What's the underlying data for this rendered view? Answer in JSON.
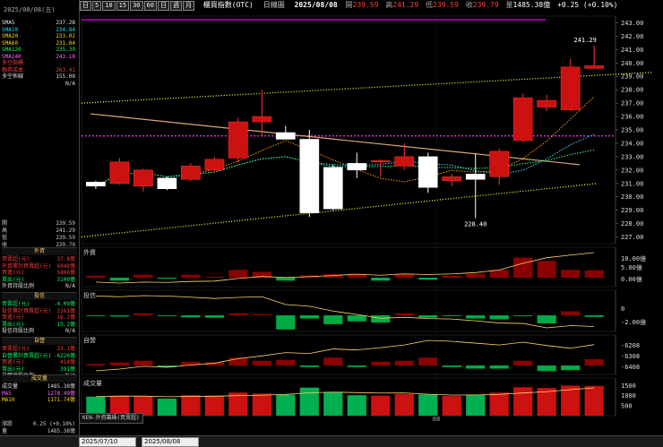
{
  "header": {
    "title": "櫃買指數(OTC)",
    "view": "日線圖",
    "date": "2025/08/08",
    "open_label": "開",
    "open": "239.59",
    "high_label": "高",
    "high": "241.29",
    "low_label": "低",
    "low": "239.59",
    "close_label": "收",
    "close": "239.79",
    "volume_label": "量",
    "volume": "1485.38億",
    "change": "+0.25 (+0.10%)",
    "period_buttons": [
      "日",
      "5",
      "10",
      "15",
      "30",
      "60",
      "日",
      "週",
      "月"
    ]
  },
  "left_panel": {
    "date": "2025/08/08(五)",
    "ma_rows": [
      {
        "label": "SMA5",
        "value": "237.28",
        "color": "#e6e6e6"
      },
      {
        "label": "SMA10",
        "value": "234.84",
        "color": "#00e5ff"
      },
      {
        "label": "SMA20",
        "value": "233.02",
        "color": "#ffd700"
      },
      {
        "label": "SMA60",
        "value": "231.04",
        "color": "#ffd700"
      },
      {
        "label": "SMA120",
        "value": "235.39",
        "color": "#00ff66"
      },
      {
        "label": "SMA240",
        "value": "243.18",
        "color": "#ff66ff"
      },
      {
        "label": "多空指標",
        "value": "",
        "color": "#ff3b3b"
      },
      {
        "label": "融券成本",
        "value": "263.41",
        "color": "#ff3b3b"
      },
      {
        "label": "多空佈線",
        "value": "155.08",
        "color": "#ddd"
      },
      {
        "label": "",
        "value": "N/A",
        "color": "#ddd"
      }
    ],
    "ohlc_rows": [
      {
        "label": "開",
        "value": "239.59"
      },
      {
        "label": "高",
        "value": "241.29"
      },
      {
        "label": "低",
        "value": "239.59"
      },
      {
        "label": "收",
        "value": "239.79"
      }
    ],
    "sections": [
      {
        "title": "外資",
        "rows": [
          {
            "label": "買賣超(元)",
            "value": "37.8億",
            "color": "#ff3b3b"
          },
          {
            "label": "外資累計買賣超(元)",
            "value": "6948億",
            "color": "#ff3b3b"
          },
          {
            "label": "買進(元)",
            "value": "5866億",
            "color": "#ff3b3b"
          },
          {
            "label": "賣出(元)",
            "value": "3100億",
            "color": "#00ff66"
          },
          {
            "label": "外資持股比例",
            "value": "N/A",
            "color": "#ddd"
          }
        ]
      },
      {
        "title": "投信",
        "rows": [
          {
            "label": "買賣超(元)",
            "value": "-4.09億",
            "color": "#00ff66"
          },
          {
            "label": "投信累計買賣超(元)",
            "value": "2161億",
            "color": "#ff3b3b"
          },
          {
            "label": "買進(元)",
            "value": "16.2億",
            "color": "#ff3b3b"
          },
          {
            "label": "賣出(元)",
            "value": "15.2億",
            "color": "#00ff66"
          },
          {
            "label": "投信持股比例",
            "value": "N/A",
            "color": "#ddd"
          }
        ]
      },
      {
        "title": "自營",
        "rows": [
          {
            "label": "買賣超(元)",
            "value": "23.1億",
            "color": "#ff3b3b"
          },
          {
            "label": "自營累計買賣超(元)",
            "value": "-6226億",
            "color": "#00ff66"
          },
          {
            "label": "買進(元)",
            "value": "414億",
            "color": "#ff3b3b"
          },
          {
            "label": "賣出(元)",
            "value": "391億",
            "color": "#00ff66"
          },
          {
            "label": "自營持股比例",
            "value": "N/A",
            "color": "#ddd"
          }
        ]
      },
      {
        "title": "成交量",
        "rows": [
          {
            "label": "成交量",
            "value": "1485.38億",
            "color": "#ddd"
          },
          {
            "label": "MA5",
            "value": "1278.49億",
            "color": "#ff66ff"
          },
          {
            "label": "MA10",
            "value": "1171.74億",
            "color": "#ffd700"
          }
        ]
      }
    ],
    "bottom_labels": [
      "漲跌",
      "量"
    ],
    "bottom_values": [
      "0.25 (+0.10%)",
      "1485.38億"
    ],
    "indicator_tab": "KEN-外資籌碼(買賣超)"
  },
  "price_axis": [
    "243.00",
    "242.00",
    "241.00",
    "240.00",
    "239.00",
    "238.00",
    "237.00",
    "236.00",
    "235.00",
    "234.00",
    "233.00",
    "232.00",
    "231.00",
    "230.00",
    "229.00",
    "228.00",
    "227.00"
  ],
  "annotations": {
    "high_label": "241.29",
    "low_label": "228.40",
    "start_date": "2025/07/10",
    "mid_date": "08"
  },
  "panels": [
    {
      "name": "外資",
      "axis": [
        "10.00億",
        "5.00億",
        "0.00億"
      ]
    },
    {
      "name": "投信",
      "axis": [
        "0",
        "-2.00億"
      ]
    },
    {
      "name": "自營",
      "axis": [
        "-6208",
        "-6308",
        "-6408"
      ]
    },
    {
      "name": "成交量",
      "axis": [
        "1500",
        "1000",
        "500"
      ]
    }
  ],
  "chart_data": {
    "type": "candlestick",
    "ylim": [
      226.5,
      243.5
    ],
    "candles": [
      {
        "o": 231.1,
        "h": 231.2,
        "l": 230.6,
        "c": 230.8
      },
      {
        "o": 231.0,
        "h": 232.9,
        "l": 230.9,
        "c": 232.6
      },
      {
        "o": 230.8,
        "h": 232.1,
        "l": 230.4,
        "c": 232.0
      },
      {
        "o": 231.4,
        "h": 231.5,
        "l": 230.5,
        "c": 230.6
      },
      {
        "o": 231.3,
        "h": 232.5,
        "l": 231.2,
        "c": 232.3
      },
      {
        "o": 232.0,
        "h": 233.0,
        "l": 231.8,
        "c": 232.8
      },
      {
        "o": 232.9,
        "h": 235.9,
        "l": 232.6,
        "c": 235.6
      },
      {
        "o": 235.6,
        "h": 238.0,
        "l": 234.6,
        "c": 236.0
      },
      {
        "o": 234.8,
        "h": 235.3,
        "l": 234.4,
        "c": 234.3
      },
      {
        "o": 234.3,
        "h": 235.0,
        "l": 228.5,
        "c": 228.8
      },
      {
        "o": 232.2,
        "h": 232.4,
        "l": 229.0,
        "c": 229.1
      },
      {
        "o": 232.5,
        "h": 233.3,
        "l": 231.4,
        "c": 232.0
      },
      {
        "o": 232.6,
        "h": 232.8,
        "l": 231.5,
        "c": 232.7
      },
      {
        "o": 232.3,
        "h": 234.0,
        "l": 232.0,
        "c": 233.0
      },
      {
        "o": 233.0,
        "h": 233.3,
        "l": 230.3,
        "c": 230.7
      },
      {
        "o": 231.2,
        "h": 231.7,
        "l": 230.8,
        "c": 231.5
      },
      {
        "o": 231.7,
        "h": 233.2,
        "l": 228.4,
        "c": 231.3
      },
      {
        "o": 231.5,
        "h": 233.6,
        "l": 230.9,
        "c": 233.4
      },
      {
        "o": 234.2,
        "h": 237.7,
        "l": 234.1,
        "c": 237.4
      },
      {
        "o": 236.7,
        "h": 237.6,
        "l": 236.4,
        "c": 237.2
      },
      {
        "o": 236.5,
        "h": 240.3,
        "l": 236.4,
        "c": 239.7
      },
      {
        "o": 239.59,
        "h": 241.29,
        "l": 239.59,
        "c": 239.79
      }
    ],
    "foreign": [
      1.0,
      -1.5,
      1.5,
      -0.5,
      1.5,
      0.5,
      4.0,
      3.0,
      -1.5,
      1.2,
      1.8,
      2.0,
      -1.5,
      2.0,
      -1.0,
      1.0,
      2.0,
      4.0,
      10.2,
      8.5,
      4.0,
      3.8
    ],
    "trust": [
      -0.2,
      -0.3,
      0.5,
      -0.2,
      -0.5,
      -0.6,
      0.5,
      0.3,
      -3.5,
      -0.8,
      -2.2,
      -1.5,
      -1.8,
      0.5,
      -0.6,
      -0.2,
      -0.8,
      -1.0,
      -0.2,
      -2.0,
      1.0,
      -0.4
    ],
    "dealer": [
      0.5,
      1.0,
      1.5,
      -0.5,
      1.2,
      1.0,
      2.5,
      1.5,
      1.8,
      -0.5,
      2.5,
      -0.5,
      1.2,
      1.5,
      2.5,
      -0.5,
      -1.0,
      -1.0,
      1.5,
      -1.8,
      -1.5,
      2.0
    ],
    "volume": [
      950,
      1000,
      980,
      850,
      1020,
      1000,
      1150,
      1100,
      1050,
      1400,
      1180,
      1020,
      1000,
      1080,
      1060,
      980,
      1050,
      1150,
      1420,
      1380,
      1500,
      1485
    ]
  }
}
